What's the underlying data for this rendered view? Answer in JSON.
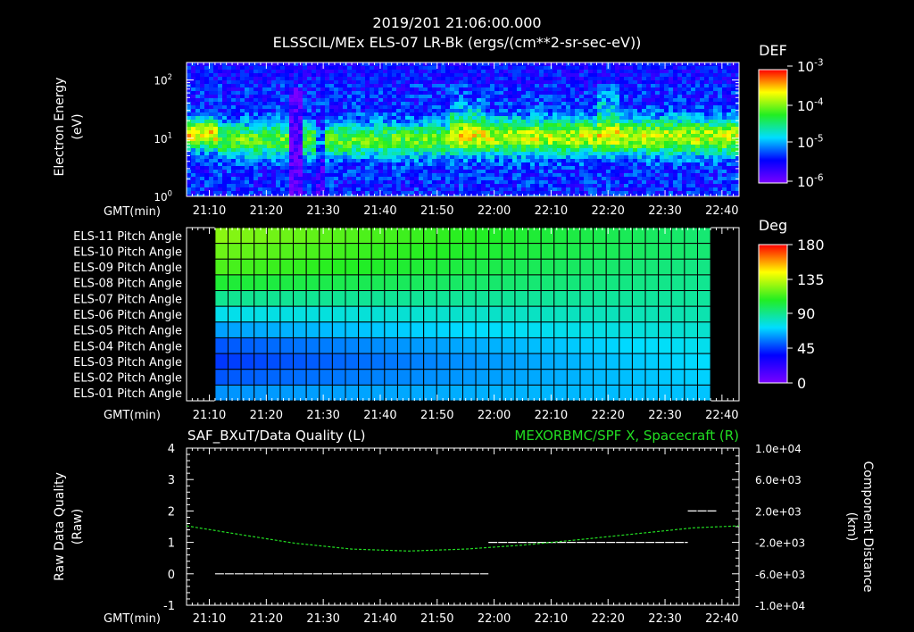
{
  "header": {
    "timestamp": "2019/201 21:06:00.000",
    "title": "ELSSCIL/MEx ELS-07 LR-Bk  (ergs/(cm**2-sr-sec-eV))"
  },
  "time_axis": {
    "label": "GMT(min)",
    "ticks": [
      "21:10",
      "21:20",
      "21:30",
      "21:40",
      "21:50",
      "22:00",
      "22:10",
      "22:20",
      "22:30",
      "22:40"
    ]
  },
  "colors": {
    "background": "#000000",
    "axis": "#ffffff",
    "quality_line": "#ffffff",
    "spacecraft_line": "#22dd22",
    "right_title": "#22dd22"
  },
  "chart_data": [
    {
      "type": "heatmap",
      "name": "electron-spectrogram",
      "ylabel": [
        "Electron Energy",
        "(eV)"
      ],
      "y_scale": "log",
      "ylim": [
        1,
        200
      ],
      "yticks": [
        {
          "value": 1,
          "base": "10",
          "exp": "0"
        },
        {
          "value": 10,
          "base": "10",
          "exp": "1"
        },
        {
          "value": 100,
          "base": "10",
          "exp": "2"
        }
      ],
      "xlim": [
        "21:06",
        "22:43"
      ],
      "colorbar": {
        "label": "DEF",
        "ticks": [
          {
            "base": "10",
            "exp": "-3"
          },
          {
            "base": "10",
            "exp": "-4"
          },
          {
            "base": "10",
            "exp": "-5"
          },
          {
            "base": "10",
            "exp": "-6"
          }
        ]
      },
      "features": [
        {
          "time": "21:08",
          "energy_center_ev": 12,
          "level": "high"
        },
        {
          "time": "21:25",
          "energy_center_ev": 8,
          "level": "data gap"
        },
        {
          "time": "21:55",
          "energy_center_ev": 15,
          "level": "enhanced"
        },
        {
          "time": "22:20",
          "energy_center_ev": 20,
          "level": "enhanced"
        }
      ]
    },
    {
      "type": "heatmap",
      "name": "pitch-angle-grid",
      "rows": [
        "ELS-11 Pitch Angle",
        "ELS-10 Pitch Angle",
        "ELS-09 Pitch Angle",
        "ELS-08 Pitch Angle",
        "ELS-07 Pitch Angle",
        "ELS-06 Pitch Angle",
        "ELS-05 Pitch Angle",
        "ELS-04 Pitch Angle",
        "ELS-03 Pitch Angle",
        "ELS-02 Pitch Angle",
        "ELS-01 Pitch Angle"
      ],
      "data_start": "21:11",
      "data_end": "22:38",
      "pitch_angle_deg_start": [
        125,
        120,
        115,
        105,
        90,
        75,
        62,
        50,
        45,
        50,
        60
      ],
      "pitch_angle_deg_end": [
        95,
        95,
        92,
        90,
        88,
        85,
        80,
        75,
        72,
        70,
        68
      ],
      "colorbar": {
        "label": "Deg",
        "ticks": [
          "180",
          "135",
          "90",
          "45",
          "0"
        ],
        "range": [
          0,
          180
        ]
      }
    },
    {
      "type": "line",
      "name": "quality-and-position",
      "left_title": "SAF_BXuT/Data Quality (L)",
      "right_title": "MEXORBMC/SPF X, Spacecraft (R)",
      "ylabel_left": [
        "Raw Data Quality",
        "(Raw)"
      ],
      "ylabel_right": [
        "Component Distance",
        "(km)"
      ],
      "ylim_left": [
        -1,
        4
      ],
      "yticks_left": [
        "4",
        "3",
        "2",
        "1",
        "0",
        "-1"
      ],
      "ylim_right": [
        -10000,
        10000
      ],
      "yticks_right": [
        "1.0e+04",
        "6.0e+03",
        "2.0e+03",
        "-2.0e+03",
        "-6.0e+03",
        "-1.0e+04"
      ],
      "series": [
        {
          "axis": "left",
          "segments": [
            {
              "start": "21:11",
              "end": "21:59",
              "value": 0
            },
            {
              "start": "21:59",
              "end": "22:34",
              "value": 1
            },
            {
              "start": "22:34",
              "end": "22:39",
              "value": 2
            }
          ]
        },
        {
          "axis": "right",
          "x": [
            "21:06",
            "21:15",
            "21:25",
            "21:35",
            "21:45",
            "21:55",
            "22:05",
            "22:15",
            "22:25",
            "22:35",
            "22:43"
          ],
          "values": [
            105,
            -950,
            -2100,
            -2850,
            -3100,
            -2850,
            -2350,
            -1650,
            -900,
            -150,
            100
          ]
        }
      ]
    }
  ]
}
